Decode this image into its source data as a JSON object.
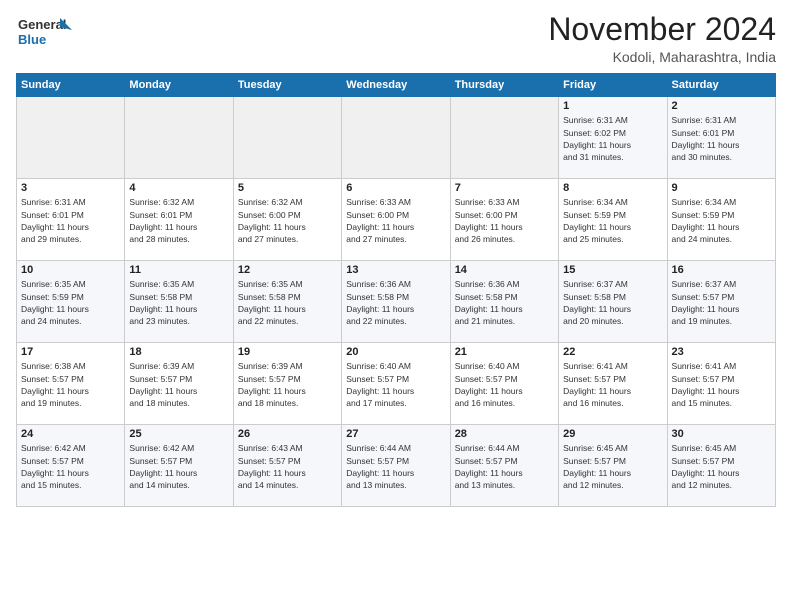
{
  "logo": {
    "text_general": "General",
    "text_blue": "Blue"
  },
  "header": {
    "month_year": "November 2024",
    "location": "Kodoli, Maharashtra, India"
  },
  "weekdays": [
    "Sunday",
    "Monday",
    "Tuesday",
    "Wednesday",
    "Thursday",
    "Friday",
    "Saturday"
  ],
  "weeks": [
    [
      {
        "day": "",
        "info": ""
      },
      {
        "day": "",
        "info": ""
      },
      {
        "day": "",
        "info": ""
      },
      {
        "day": "",
        "info": ""
      },
      {
        "day": "",
        "info": ""
      },
      {
        "day": "1",
        "info": "Sunrise: 6:31 AM\nSunset: 6:02 PM\nDaylight: 11 hours\nand 31 minutes."
      },
      {
        "day": "2",
        "info": "Sunrise: 6:31 AM\nSunset: 6:01 PM\nDaylight: 11 hours\nand 30 minutes."
      }
    ],
    [
      {
        "day": "3",
        "info": "Sunrise: 6:31 AM\nSunset: 6:01 PM\nDaylight: 11 hours\nand 29 minutes."
      },
      {
        "day": "4",
        "info": "Sunrise: 6:32 AM\nSunset: 6:01 PM\nDaylight: 11 hours\nand 28 minutes."
      },
      {
        "day": "5",
        "info": "Sunrise: 6:32 AM\nSunset: 6:00 PM\nDaylight: 11 hours\nand 27 minutes."
      },
      {
        "day": "6",
        "info": "Sunrise: 6:33 AM\nSunset: 6:00 PM\nDaylight: 11 hours\nand 27 minutes."
      },
      {
        "day": "7",
        "info": "Sunrise: 6:33 AM\nSunset: 6:00 PM\nDaylight: 11 hours\nand 26 minutes."
      },
      {
        "day": "8",
        "info": "Sunrise: 6:34 AM\nSunset: 5:59 PM\nDaylight: 11 hours\nand 25 minutes."
      },
      {
        "day": "9",
        "info": "Sunrise: 6:34 AM\nSunset: 5:59 PM\nDaylight: 11 hours\nand 24 minutes."
      }
    ],
    [
      {
        "day": "10",
        "info": "Sunrise: 6:35 AM\nSunset: 5:59 PM\nDaylight: 11 hours\nand 24 minutes."
      },
      {
        "day": "11",
        "info": "Sunrise: 6:35 AM\nSunset: 5:58 PM\nDaylight: 11 hours\nand 23 minutes."
      },
      {
        "day": "12",
        "info": "Sunrise: 6:35 AM\nSunset: 5:58 PM\nDaylight: 11 hours\nand 22 minutes."
      },
      {
        "day": "13",
        "info": "Sunrise: 6:36 AM\nSunset: 5:58 PM\nDaylight: 11 hours\nand 22 minutes."
      },
      {
        "day": "14",
        "info": "Sunrise: 6:36 AM\nSunset: 5:58 PM\nDaylight: 11 hours\nand 21 minutes."
      },
      {
        "day": "15",
        "info": "Sunrise: 6:37 AM\nSunset: 5:58 PM\nDaylight: 11 hours\nand 20 minutes."
      },
      {
        "day": "16",
        "info": "Sunrise: 6:37 AM\nSunset: 5:57 PM\nDaylight: 11 hours\nand 19 minutes."
      }
    ],
    [
      {
        "day": "17",
        "info": "Sunrise: 6:38 AM\nSunset: 5:57 PM\nDaylight: 11 hours\nand 19 minutes."
      },
      {
        "day": "18",
        "info": "Sunrise: 6:39 AM\nSunset: 5:57 PM\nDaylight: 11 hours\nand 18 minutes."
      },
      {
        "day": "19",
        "info": "Sunrise: 6:39 AM\nSunset: 5:57 PM\nDaylight: 11 hours\nand 18 minutes."
      },
      {
        "day": "20",
        "info": "Sunrise: 6:40 AM\nSunset: 5:57 PM\nDaylight: 11 hours\nand 17 minutes."
      },
      {
        "day": "21",
        "info": "Sunrise: 6:40 AM\nSunset: 5:57 PM\nDaylight: 11 hours\nand 16 minutes."
      },
      {
        "day": "22",
        "info": "Sunrise: 6:41 AM\nSunset: 5:57 PM\nDaylight: 11 hours\nand 16 minutes."
      },
      {
        "day": "23",
        "info": "Sunrise: 6:41 AM\nSunset: 5:57 PM\nDaylight: 11 hours\nand 15 minutes."
      }
    ],
    [
      {
        "day": "24",
        "info": "Sunrise: 6:42 AM\nSunset: 5:57 PM\nDaylight: 11 hours\nand 15 minutes."
      },
      {
        "day": "25",
        "info": "Sunrise: 6:42 AM\nSunset: 5:57 PM\nDaylight: 11 hours\nand 14 minutes."
      },
      {
        "day": "26",
        "info": "Sunrise: 6:43 AM\nSunset: 5:57 PM\nDaylight: 11 hours\nand 14 minutes."
      },
      {
        "day": "27",
        "info": "Sunrise: 6:44 AM\nSunset: 5:57 PM\nDaylight: 11 hours\nand 13 minutes."
      },
      {
        "day": "28",
        "info": "Sunrise: 6:44 AM\nSunset: 5:57 PM\nDaylight: 11 hours\nand 13 minutes."
      },
      {
        "day": "29",
        "info": "Sunrise: 6:45 AM\nSunset: 5:57 PM\nDaylight: 11 hours\nand 12 minutes."
      },
      {
        "day": "30",
        "info": "Sunrise: 6:45 AM\nSunset: 5:57 PM\nDaylight: 11 hours\nand 12 minutes."
      }
    ]
  ]
}
